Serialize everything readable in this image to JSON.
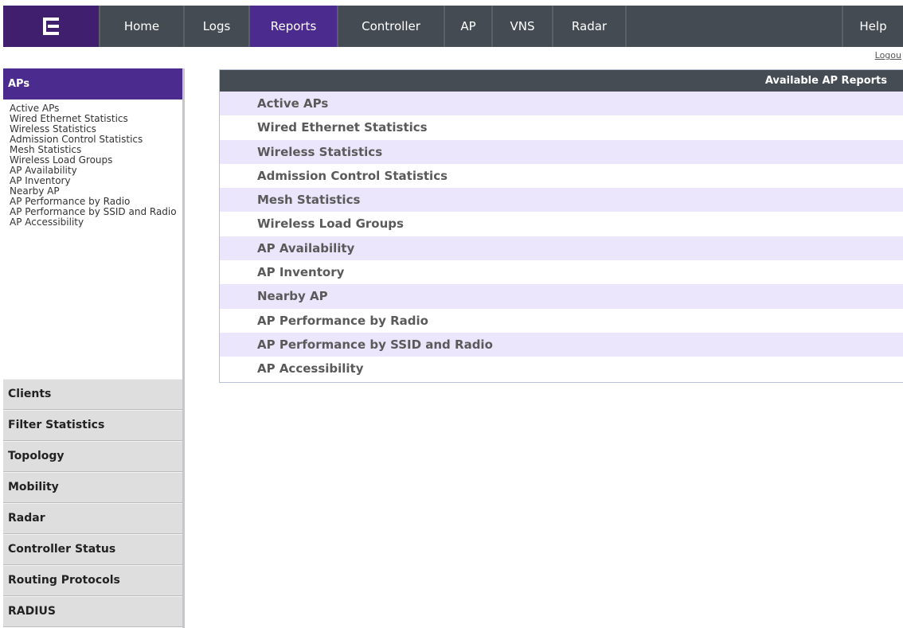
{
  "nav": {
    "logo_icon": "extreme-logo-icon",
    "items": [
      "Home",
      "Logs",
      "Reports",
      "Controller",
      "AP",
      "VNS",
      "Radar"
    ],
    "help": "Help",
    "active": "Reports"
  },
  "logout": "Logou",
  "sidebar": {
    "active_section": "APs",
    "links": [
      "Active APs",
      "Wired Ethernet Statistics",
      "Wireless Statistics",
      "Admission Control Statistics",
      "Mesh Statistics",
      "Wireless Load Groups",
      "AP Availability",
      "AP Inventory",
      "Nearby AP",
      "AP Performance by Radio",
      "AP Performance by SSID and Radio",
      "AP Accessibility"
    ],
    "sections": [
      "Clients",
      "Filter Statistics",
      "Topology",
      "Mobility",
      "Radar",
      "Controller Status",
      "Routing Protocols",
      "RADIUS"
    ]
  },
  "panel": {
    "title": "Available AP Reports",
    "reports": [
      "Active APs",
      "Wired Ethernet Statistics",
      "Wireless Statistics",
      "Admission Control Statistics",
      "Mesh Statistics",
      "Wireless Load Groups",
      "AP Availability",
      "AP Inventory",
      "Nearby AP",
      "AP Performance by Radio",
      "AP Performance by SSID and Radio",
      "AP Accessibility"
    ]
  },
  "colors": {
    "brand_purple": "#4c2b8f",
    "nav_dark": "#444b52",
    "row_alt": "#ebe6fb"
  }
}
